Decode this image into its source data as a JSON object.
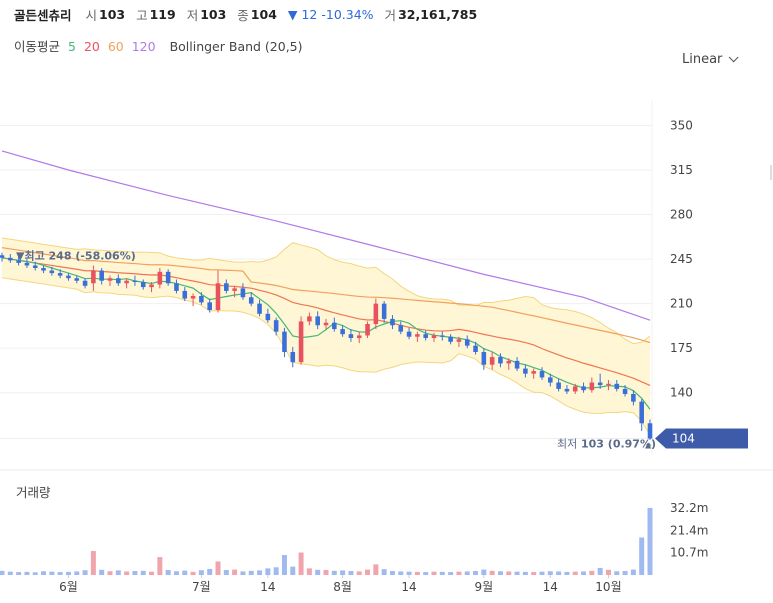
{
  "header": {
    "stock_name": "골든센츄리",
    "open_label": "시",
    "open": "103",
    "high_label": "고",
    "high": "119",
    "low_label": "저",
    "low": "103",
    "close_label": "종",
    "close": "104",
    "change_arrow": "▼",
    "change": "12",
    "change_pct": "-10.34%",
    "volume_label": "거",
    "volume": "32,161,785"
  },
  "indicators": {
    "ma_label": "이동평균",
    "ma5": "5",
    "ma20": "20",
    "ma60": "60",
    "ma120": "120",
    "bb_label": "Bollinger Band (20,5)"
  },
  "scale_selector": {
    "label": "Linear"
  },
  "volume_panel": {
    "title": "거래량"
  },
  "colors": {
    "up": "#e8525f",
    "down": "#3a6fd8",
    "ma5": "#45b87a",
    "ma20": "#ef7650",
    "ma60": "#f2a15c",
    "ma120": "#b07be8",
    "band_fill": "#fff6d6",
    "band_line": "#f4d67c",
    "price_tag": "#3d5ba8"
  },
  "chart_data": {
    "type": "candlestick",
    "y_ticks": [
      350,
      315,
      280,
      245,
      210,
      175,
      140
    ],
    "y_range": [
      95,
      370
    ],
    "x_tick_labels": [
      "6월",
      "7월",
      "14",
      "8월",
      "14",
      "9월",
      "14",
      "10월"
    ],
    "last_price": "104",
    "high_annotation": "▼최고 248 (-58.06%)",
    "low_annotation_label": "최저",
    "low_annotation_value": "103 (0.97%)",
    "low_annotation_arrow": "▲",
    "volume_ticks": [
      "32.2m",
      "21.4m",
      "10.7m"
    ],
    "volume_range_m": [
      0,
      36
    ],
    "ohlc": [
      [
        248,
        250,
        243,
        246
      ],
      [
        246,
        249,
        242,
        244
      ],
      [
        244,
        247,
        240,
        242
      ],
      [
        242,
        245,
        238,
        240
      ],
      [
        240,
        243,
        236,
        238
      ],
      [
        238,
        240,
        234,
        236
      ],
      [
        236,
        239,
        232,
        234
      ],
      [
        234,
        237,
        230,
        232
      ],
      [
        232,
        234,
        228,
        230
      ],
      [
        230,
        232,
        226,
        228
      ],
      [
        228,
        230,
        222,
        224
      ],
      [
        226,
        240,
        220,
        236
      ],
      [
        236,
        238,
        225,
        228
      ],
      [
        228,
        232,
        224,
        230
      ],
      [
        230,
        233,
        224,
        226
      ],
      [
        226,
        230,
        222,
        228
      ],
      [
        228,
        232,
        224,
        227
      ],
      [
        227,
        229,
        221,
        223
      ],
      [
        223,
        227,
        219,
        225
      ],
      [
        225,
        238,
        222,
        235
      ],
      [
        235,
        237,
        224,
        226
      ],
      [
        226,
        229,
        218,
        220
      ],
      [
        220,
        223,
        212,
        214
      ],
      [
        214,
        218,
        208,
        216
      ],
      [
        216,
        219,
        209,
        211
      ],
      [
        211,
        214,
        203,
        205
      ],
      [
        205,
        236,
        203,
        226
      ],
      [
        226,
        229,
        218,
        220
      ],
      [
        220,
        224,
        215,
        222
      ],
      [
        222,
        226,
        213,
        215
      ],
      [
        215,
        219,
        208,
        210
      ],
      [
        210,
        213,
        200,
        202
      ],
      [
        202,
        206,
        195,
        197
      ],
      [
        197,
        199,
        185,
        188
      ],
      [
        188,
        191,
        168,
        172
      ],
      [
        172,
        176,
        160,
        164
      ],
      [
        164,
        200,
        162,
        196
      ],
      [
        196,
        203,
        193,
        200
      ],
      [
        200,
        204,
        190,
        193
      ],
      [
        193,
        198,
        190,
        195
      ],
      [
        195,
        199,
        188,
        190
      ],
      [
        190,
        193,
        184,
        186
      ],
      [
        186,
        190,
        180,
        183
      ],
      [
        183,
        188,
        179,
        185
      ],
      [
        185,
        196,
        183,
        194
      ],
      [
        194,
        214,
        190,
        210
      ],
      [
        210,
        212,
        195,
        198
      ],
      [
        198,
        201,
        190,
        193
      ],
      [
        193,
        196,
        186,
        188
      ],
      [
        188,
        191,
        182,
        184
      ],
      [
        184,
        188,
        180,
        186
      ],
      [
        186,
        189,
        181,
        183
      ],
      [
        183,
        187,
        180,
        185
      ],
      [
        185,
        188,
        181,
        184
      ],
      [
        184,
        186,
        178,
        180
      ],
      [
        180,
        184,
        176,
        182
      ],
      [
        182,
        185,
        175,
        177
      ],
      [
        177,
        180,
        170,
        172
      ],
      [
        172,
        175,
        158,
        162
      ],
      [
        162,
        172,
        158,
        168
      ],
      [
        168,
        171,
        160,
        163
      ],
      [
        163,
        167,
        158,
        165
      ],
      [
        165,
        168,
        157,
        159
      ],
      [
        159,
        162,
        152,
        155
      ],
      [
        155,
        159,
        151,
        157
      ],
      [
        157,
        160,
        150,
        152
      ],
      [
        152,
        155,
        145,
        148
      ],
      [
        148,
        151,
        141,
        143
      ],
      [
        143,
        146,
        139,
        141
      ],
      [
        141,
        147,
        139,
        145
      ],
      [
        145,
        148,
        140,
        142
      ],
      [
        142,
        152,
        140,
        148
      ],
      [
        148,
        155,
        143,
        146
      ],
      [
        146,
        150,
        142,
        147
      ],
      [
        147,
        150,
        141,
        143
      ],
      [
        143,
        146,
        137,
        139
      ],
      [
        139,
        142,
        130,
        133
      ],
      [
        133,
        135,
        110,
        116
      ],
      [
        116,
        119,
        103,
        104
      ]
    ],
    "volume_m": [
      2.0,
      1.6,
      1.4,
      1.5,
      1.3,
      1.8,
      1.6,
      1.4,
      1.5,
      1.7,
      2.3,
      11.5,
      2.5,
      1.8,
      2.2,
      1.7,
      1.9,
      2.0,
      1.6,
      8.6,
      2.4,
      1.8,
      2.1,
      1.5,
      2.3,
      2.9,
      6.5,
      2.4,
      2.6,
      1.7,
      2.0,
      2.2,
      3.2,
      3.7,
      9.6,
      4.0,
      10.8,
      3.2,
      2.5,
      2.4,
      2.0,
      2.2,
      1.9,
      1.7,
      2.6,
      5.1,
      2.8,
      1.9,
      1.7,
      1.6,
      1.5,
      1.4,
      1.6,
      1.5,
      1.4,
      1.6,
      1.7,
      1.9,
      2.6,
      2.0,
      1.8,
      1.7,
      1.6,
      1.5,
      1.4,
      1.6,
      1.8,
      1.7,
      1.5,
      1.6,
      1.7,
      2.0,
      3.4,
      2.5,
      1.8,
      1.9,
      2.6,
      18.0,
      32.2
    ],
    "ma120_points": [
      [
        0,
        330
      ],
      [
        8,
        315
      ],
      [
        20,
        295
      ],
      [
        33,
        275
      ],
      [
        45,
        255
      ],
      [
        58,
        233
      ],
      [
        70,
        215
      ],
      [
        78,
        197
      ]
    ]
  }
}
